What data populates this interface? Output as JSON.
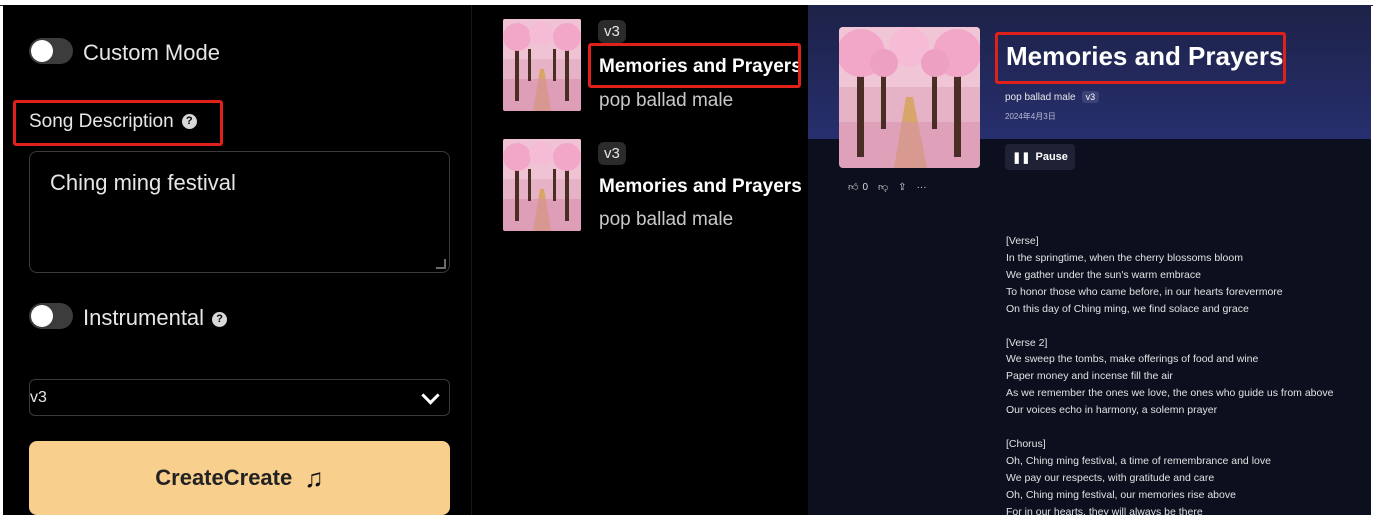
{
  "left": {
    "custom_mode_label": "Custom Mode",
    "song_description_label": "Song Description",
    "description_value": "Ching ming festival",
    "instrumental_label": "Instrumental",
    "version_value": "v3",
    "create_label": "CreateCreate"
  },
  "list": [
    {
      "version": "v3",
      "title": "Memories and Prayers",
      "subtitle": "pop ballad male"
    },
    {
      "version": "v3",
      "title": "Memories and Prayers",
      "subtitle": "pop ballad male"
    }
  ],
  "detail": {
    "title": "Memories and Prayers",
    "style": "pop ballad male",
    "version": "v3",
    "date": "2024年4月3日",
    "pause_label": "Pause",
    "like_count": "0",
    "lyrics": [
      "[Verse]",
      "In the springtime, when the cherry blossoms bloom",
      "We gather under the sun's warm embrace",
      "To honor those who came before, in our hearts forevermore",
      "On this day of Ching ming, we find solace and grace",
      "",
      "[Verse 2]",
      "We sweep the tombs, make offerings of food and wine",
      "Paper money and incense fill the air",
      "As we remember the ones we love, the ones who guide us from above",
      "Our voices echo in harmony, a solemn prayer",
      "",
      "[Chorus]",
      "Oh, Ching ming festival, a time of remembrance and love",
      "We pay our respects, with gratitude and care",
      "Oh, Ching ming festival, our memories rise above",
      "For in our hearts, they will always be there"
    ]
  },
  "colors": {
    "create_button": "#f8cf8c",
    "highlight_box": "#e0201b",
    "detail_header": "#272f6e"
  },
  "icons": [
    "question-icon",
    "chevron-down-icon",
    "music-note-icon",
    "pause-icon",
    "thumbs-up-icon",
    "thumbs-down-icon",
    "share-icon",
    "more-icon"
  ]
}
